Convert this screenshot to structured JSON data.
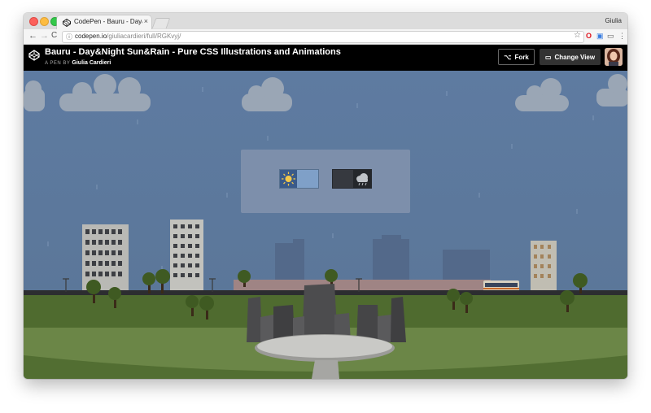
{
  "browser": {
    "tab_title": "CodePen - Bauru - Day&Night",
    "tab_close": "×",
    "profile_name": "Giulia",
    "nav_back": "←",
    "nav_forward": "→",
    "nav_reload": "C",
    "url_host": "codepen.io",
    "url_path": "/giuliacardieri/full/RGKvyj/",
    "info_icon": "ⓘ",
    "star_icon": "☆",
    "ext_opera": "O",
    "ext_square": "▣",
    "ext_cast": "▭",
    "ext_menu": "⋮"
  },
  "codepen": {
    "pen_title": "Bauru - Day&Night Sun&Rain - Pure CSS Illustrations and Animations",
    "by_prefix": "A PEN BY",
    "author": "Giulia Cardieri",
    "fork_label": "Fork",
    "fork_icon": "⌥",
    "change_view_label": "Change View",
    "change_view_icon": "▭"
  },
  "weather": {
    "day_sun_icon": "sun-icon",
    "rain_cloud_icon": "cloud-rain-icon",
    "selected_mode": "rain"
  },
  "colors": {
    "sky": "#5d7a9e",
    "grass": "#4f6b2f",
    "codepen_header": "#000000"
  }
}
